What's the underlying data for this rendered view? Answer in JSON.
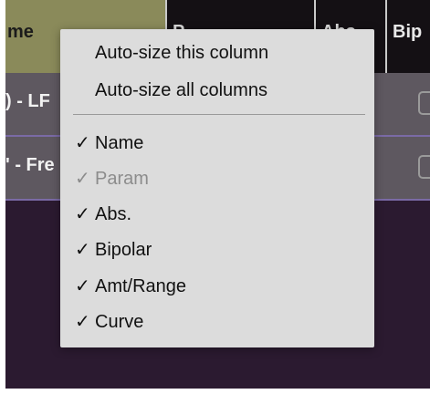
{
  "table": {
    "headers": {
      "name": "me",
      "param": "P",
      "abs": "Abs.",
      "bipolar": "Bip"
    },
    "rows": [
      {
        "name": ") - LF"
      },
      {
        "name": "' - Fre"
      }
    ]
  },
  "menu": {
    "top_items": [
      {
        "label": "Auto-size this column"
      },
      {
        "label": "Auto-size all columns"
      }
    ],
    "column_items": [
      {
        "check": "✓",
        "label": "Name",
        "enabled": true
      },
      {
        "check": "✓",
        "label": "Param",
        "enabled": false
      },
      {
        "check": "✓",
        "label": "Abs.",
        "enabled": true
      },
      {
        "check": "✓",
        "label": "Bipolar",
        "enabled": true
      },
      {
        "check": "✓",
        "label": "Amt/Range",
        "enabled": true
      },
      {
        "check": "✓",
        "label": "Curve",
        "enabled": true
      }
    ]
  },
  "colors": {
    "name_header_bg": "#8a8a5a",
    "row_bg": "#5e5860",
    "panel_bg": "#2b1a30",
    "menu_bg": "#dcdcdc",
    "disabled_text": "#8c8c8c"
  }
}
